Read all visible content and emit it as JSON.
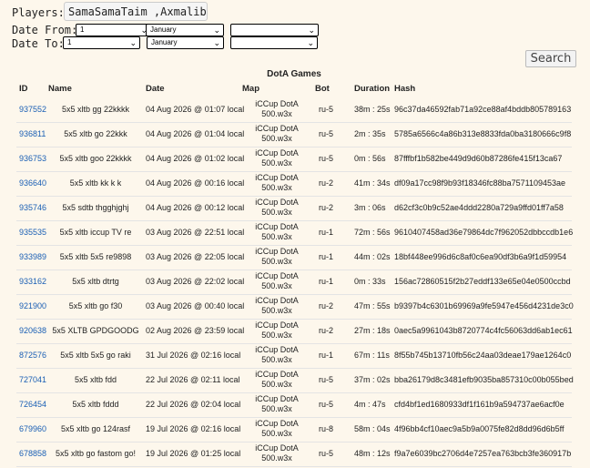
{
  "filters": {
    "players_label": "Players:",
    "players_value": "SamaSamaTaim ,Axmalibari",
    "date_from_label": "Date From:",
    "date_to_label": "Date To:",
    "from_day": "1",
    "from_month": "January",
    "from_year": "",
    "to_day": "1",
    "to_month": "January",
    "to_year": "",
    "search_label": "Search"
  },
  "table": {
    "caption": "DotA Games",
    "headers": {
      "id": "ID",
      "name": "Name",
      "date": "Date",
      "map": "Map",
      "bot": "Bot",
      "duration": "Duration",
      "hash": "Hash"
    },
    "rows": [
      {
        "id": "937552",
        "name": "5x5 xltb gg 22kkkk",
        "date": "04 Aug 2026 @ 01:07 local",
        "map1": "iCCup DotA",
        "map2": "500.w3x",
        "bot": "ru-5",
        "duration": "38m : 25s",
        "hash": "96c37da46592fab71a92ce88af4bddb805789163"
      },
      {
        "id": "936811",
        "name": "5x5 xltb go 22kkk",
        "date": "04 Aug 2026 @ 01:04 local",
        "map1": "iCCup DotA",
        "map2": "500.w3x",
        "bot": "ru-5",
        "duration": "2m : 35s",
        "hash": "5785a6566c4a86b313e8833fda0ba3180666c9f8"
      },
      {
        "id": "936753",
        "name": "5x5 xltb goo 22kkkk",
        "date": "04 Aug 2026 @ 01:02 local",
        "map1": "iCCup DotA",
        "map2": "500.w3x",
        "bot": "ru-5",
        "duration": "0m : 56s",
        "hash": "87fffbf1b582be449d9d60b87286fe415f13ca67"
      },
      {
        "id": "936640",
        "name": "5x5 xltb kk k k",
        "date": "04 Aug 2026 @ 00:16 local",
        "map1": "iCCup DotA",
        "map2": "500.w3x",
        "bot": "ru-2",
        "duration": "41m : 34s",
        "hash": "df09a17cc98f9b93f18346fc88ba7571109453ae"
      },
      {
        "id": "935746",
        "name": "5x5 sdtb thgghjghj",
        "date": "04 Aug 2026 @ 00:12 local",
        "map1": "iCCup DotA",
        "map2": "500.w3x",
        "bot": "ru-2",
        "duration": "3m : 06s",
        "hash": "d62cf3c0b9c52ae4ddd2280a729a9ffd01ff7a58"
      },
      {
        "id": "935535",
        "name": "5x5 xltb iccup TV re",
        "date": "03 Aug 2026 @ 22:51 local",
        "map1": "iCCup DotA",
        "map2": "500.w3x",
        "bot": "ru-1",
        "duration": "72m : 56s",
        "hash": "9610407458ad36e79864dc7f962052dbbccdb1e6"
      },
      {
        "id": "933989",
        "name": "5x5 xltb 5x5 re9898",
        "date": "03 Aug 2026 @ 22:05 local",
        "map1": "iCCup DotA",
        "map2": "500.w3x",
        "bot": "ru-1",
        "duration": "44m : 02s",
        "hash": "18bf448ee996d6c8af0c6ea90df3b6a9f1d59954"
      },
      {
        "id": "933162",
        "name": "5x5 xltb dtrtg",
        "date": "03 Aug 2026 @ 22:02 local",
        "map1": "iCCup DotA",
        "map2": "500.w3x",
        "bot": "ru-1",
        "duration": "0m : 33s",
        "hash": "156ac72860515f2b27eddf133e65e04e0500ccbd"
      },
      {
        "id": "921900",
        "name": "5x5 xltb go f30",
        "date": "03 Aug 2026 @ 00:40 local",
        "map1": "iCCup DotA",
        "map2": "500.w3x",
        "bot": "ru-2",
        "duration": "47m : 55s",
        "hash": "b9397b4c6301b69969a9fe5947e456d4231de3c0"
      },
      {
        "id": "920638",
        "name": "5x5 XLTB GPDGOODG",
        "date": "02 Aug 2026 @ 23:59 local",
        "map1": "iCCup DotA",
        "map2": "500.w3x",
        "bot": "ru-2",
        "duration": "27m : 18s",
        "hash": "0aec5a9961043b8720774c4fc56063dd6ab1ec61"
      },
      {
        "id": "872576",
        "name": "5x5 xltb 5x5 go raki",
        "date": "31 Jul 2026 @ 02:16 local",
        "map1": "iCCup DotA",
        "map2": "500.w3x",
        "bot": "ru-1",
        "duration": "67m : 11s",
        "hash": "8f55b745b13710fb56c24aa03deae179ae1264c0"
      },
      {
        "id": "727041",
        "name": "5x5 xltb fdd",
        "date": "22 Jul 2026 @ 02:11 local",
        "map1": "iCCup DotA",
        "map2": "500.w3x",
        "bot": "ru-5",
        "duration": "37m : 02s",
        "hash": "bba26179d8c3481efb9035ba857310c00b055bed"
      },
      {
        "id": "726454",
        "name": "5x5 xltb fddd",
        "date": "22 Jul 2026 @ 02:04 local",
        "map1": "iCCup DotA",
        "map2": "500.w3x",
        "bot": "ru-5",
        "duration": "4m : 47s",
        "hash": "cfd4bf1ed1680933df1f161b9a594737ae6acf0e"
      },
      {
        "id": "679960",
        "name": "5x5 xltb go 124rasf",
        "date": "19 Jul 2026 @ 02:16 local",
        "map1": "iCCup DotA",
        "map2": "500.w3x",
        "bot": "ru-8",
        "duration": "58m : 04s",
        "hash": "4f96bb4cf10aec9a5b9a0075fe82d8dd96d6b5ff"
      },
      {
        "id": "678858",
        "name": "5x5 xltb go fastom go!",
        "date": "19 Jul 2026 @ 01:25 local",
        "map1": "iCCup DotA",
        "map2": "500.w3x",
        "bot": "ru-5",
        "duration": "48m : 12s",
        "hash": "f9a7e6039bc2706d4e7257ea763bcb3fe360917b"
      }
    ]
  }
}
